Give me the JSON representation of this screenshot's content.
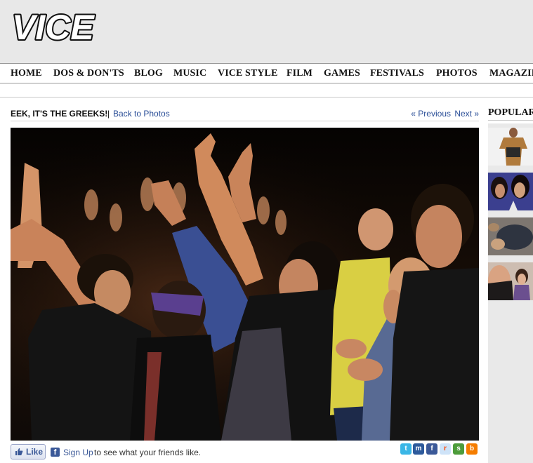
{
  "brand": {
    "logo_text": "VICE"
  },
  "nav": {
    "items": [
      {
        "label": "HOME"
      },
      {
        "label": "DOS & DON'TS"
      },
      {
        "label": "BLOG"
      },
      {
        "label": "MUSIC"
      },
      {
        "label": "VICE STYLE"
      },
      {
        "label": "FILM"
      },
      {
        "label": "GAMES"
      },
      {
        "label": "FESTIVALS"
      },
      {
        "label": "PHOTOS"
      },
      {
        "label": "MAGAZINE"
      }
    ]
  },
  "gallery": {
    "title": "EEK, IT'S THE GREEKS!",
    "separator": "|",
    "back_link": "Back to Photos",
    "previous_link": "« Previous",
    "next_link": "Next »"
  },
  "social": {
    "like_label": "Like",
    "signup_link": "Sign Up",
    "signup_text": "to see what your friends like.",
    "share_icons": [
      "twitter-icon",
      "myspace-icon",
      "facebook-icon",
      "reddit-icon",
      "stumbleupon-icon",
      "blogger-icon"
    ]
  },
  "sidebar": {
    "title": "POPULAR"
  },
  "colors": {
    "link": "#2a4e97",
    "masthead_bg": "#e8e8e8",
    "facebook": "#3b5998"
  }
}
